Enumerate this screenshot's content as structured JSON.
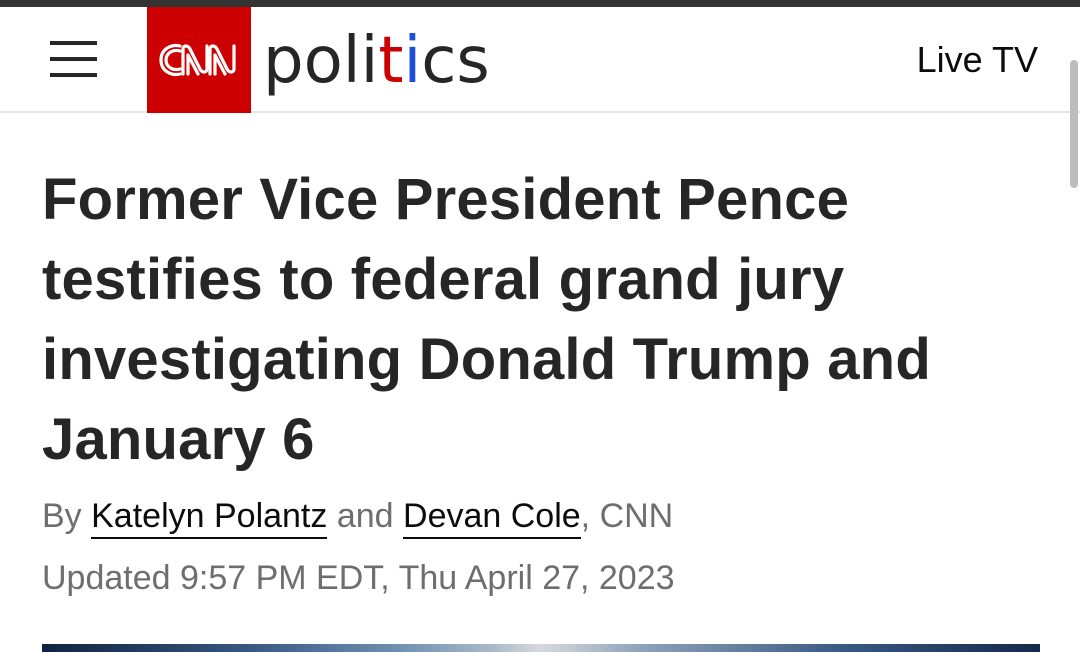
{
  "header": {
    "brand_logo_text": "CNN",
    "section_name": {
      "part1": "poli",
      "part2": "t",
      "part3": "i",
      "part4": "cs"
    },
    "live_tv_label": "Live TV",
    "colors": {
      "brand_red": "#cc0000",
      "accent_blue": "#1d4ed8",
      "text_dark": "#262626",
      "meta_gray": "#6e6e6e"
    }
  },
  "article": {
    "headline": "Former Vice President Pence testifies to federal grand jury investigating Donald Trump and January 6",
    "byline": {
      "prefix": "By ",
      "authors": [
        "Katelyn Polantz",
        "Devan Cole"
      ],
      "joiner": " and ",
      "suffix": ", CNN"
    },
    "updated": "Updated 9:57 PM EDT, Thu April 27, 2023"
  },
  "icons": {
    "menu": "hamburger-menu-icon"
  }
}
